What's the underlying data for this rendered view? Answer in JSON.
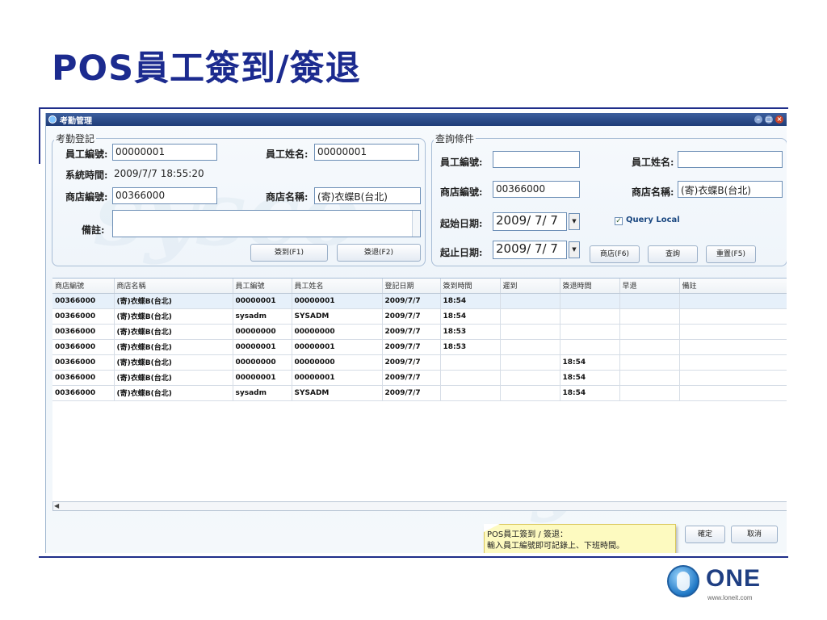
{
  "slide": {
    "title": "POS員工簽到/簽退"
  },
  "window": {
    "title": "考勤管理",
    "controls": {
      "minimize": "–",
      "maximize": "□",
      "close": "×"
    }
  },
  "registration": {
    "legend": "考勤登記",
    "employee_id_label": "員工編號:",
    "employee_id_value": "00000001",
    "employee_name_label": "員工姓名:",
    "employee_name_value": "00000001",
    "system_time_label": "系統時間:",
    "system_time_value": "2009/7/7 18:55:20",
    "store_id_label": "商店編號:",
    "store_id_value": "00366000",
    "store_name_label": "商店名稱:",
    "store_name_value": "(寄)衣蝶B(台北)",
    "remark_label": "備註:",
    "remark_value": "",
    "sign_in_button": "簽到(F1)",
    "sign_out_button": "簽退(F2)"
  },
  "query": {
    "legend": "查詢條件",
    "employee_id_label": "員工編號:",
    "employee_id_value": "",
    "employee_name_label": "員工姓名:",
    "employee_name_value": "",
    "store_id_label": "商店編號:",
    "store_id_value": "00366000",
    "store_name_label": "商店名稱:",
    "store_name_value": "(寄)衣蝶B(台北)",
    "start_date_label": "起始日期:",
    "start_date_value": "2009/ 7/ 7",
    "end_date_label": "起止日期:",
    "end_date_value": "2009/ 7/ 7",
    "query_local_label": "Query Local",
    "query_local_checked": true,
    "store_button": "商店(F6)",
    "search_button": "查詢",
    "reset_button": "重置(F5)"
  },
  "grid": {
    "columns": [
      "商店編號",
      "商店名稱",
      "員工編號",
      "員工姓名",
      "登記日期",
      "簽到時間",
      "遲到",
      "簽退時間",
      "早退",
      "備註"
    ],
    "rows": [
      [
        "00366000",
        "(寄)衣蝶B(台北)",
        "00000001",
        "00000001",
        "2009/7/7",
        "18:54",
        "",
        "",
        "",
        ""
      ],
      [
        "00366000",
        "(寄)衣蝶B(台北)",
        "sysadm",
        "SYSADM",
        "2009/7/7",
        "18:54",
        "",
        "",
        "",
        ""
      ],
      [
        "00366000",
        "(寄)衣蝶B(台北)",
        "00000000",
        "00000000",
        "2009/7/7",
        "18:53",
        "",
        "",
        "",
        ""
      ],
      [
        "00366000",
        "(寄)衣蝶B(台北)",
        "00000001",
        "00000001",
        "2009/7/7",
        "18:53",
        "",
        "",
        "",
        ""
      ],
      [
        "00366000",
        "(寄)衣蝶B(台北)",
        "00000000",
        "00000000",
        "2009/7/7",
        "",
        "",
        "18:54",
        "",
        ""
      ],
      [
        "00366000",
        "(寄)衣蝶B(台北)",
        "00000001",
        "00000001",
        "2009/7/7",
        "",
        "",
        "18:54",
        "",
        ""
      ],
      [
        "00366000",
        "(寄)衣蝶B(台北)",
        "sysadm",
        "SYSADM",
        "2009/7/7",
        "",
        "",
        "18:54",
        "",
        ""
      ]
    ]
  },
  "tooltip": {
    "line1": "POS員工簽到 / 簽退：",
    "line2": "輸入員工編號即可記錄上、下班時間。"
  },
  "footer": {
    "ok_button": "確定",
    "cancel_button": "取消"
  },
  "logo": {
    "word": "ONE",
    "url": "www.loneit.com"
  },
  "colors": {
    "title": "#1c2b8f",
    "titlebar": "#1e3c78",
    "tooltip": "#fdfac0"
  }
}
